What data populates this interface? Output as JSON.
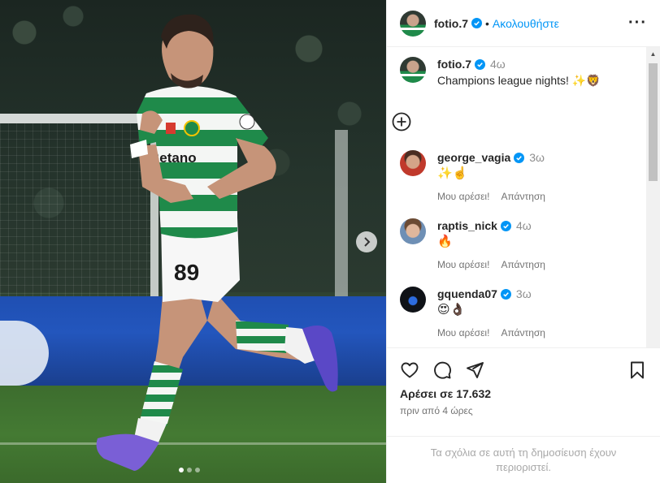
{
  "post": {
    "username": "fotio.7",
    "separator": "•",
    "follow_label": "Ακολουθήστε",
    "more_label": "···",
    "caption": {
      "time": "4ω",
      "text": "Champions league nights! ✨🦁"
    },
    "carousel": {
      "slides": 3,
      "active": 1
    }
  },
  "comments": [
    {
      "username": "george_vagia",
      "time": "3ω",
      "text": "✨☝️",
      "like_label": "Μου αρέσει!",
      "reply_label": "Απάντηση"
    },
    {
      "username": "raptis_nick",
      "time": "4ω",
      "text": "🔥",
      "like_label": "Μου αρέσει!",
      "reply_label": "Απάντηση"
    },
    {
      "username": "gquenda07",
      "time": "3ω",
      "text": "😍👌🏿",
      "like_label": "Μου αρέσει!",
      "reply_label": "Απάντηση"
    }
  ],
  "actions": {
    "likes_text": "Αρέσει σε 17.632",
    "time_ago": "πριν από 4 ώρες"
  },
  "footer": {
    "restricted_text": "Τα σχόλια σε αυτή τη δημοσίευση έχουν περιοριστεί."
  },
  "photo": {
    "jersey_number": "89",
    "sponsor": "Betano"
  },
  "colors": {
    "accent": "#0095f6",
    "verified": "#0095f6",
    "jersey_green": "#1f8a4a"
  }
}
